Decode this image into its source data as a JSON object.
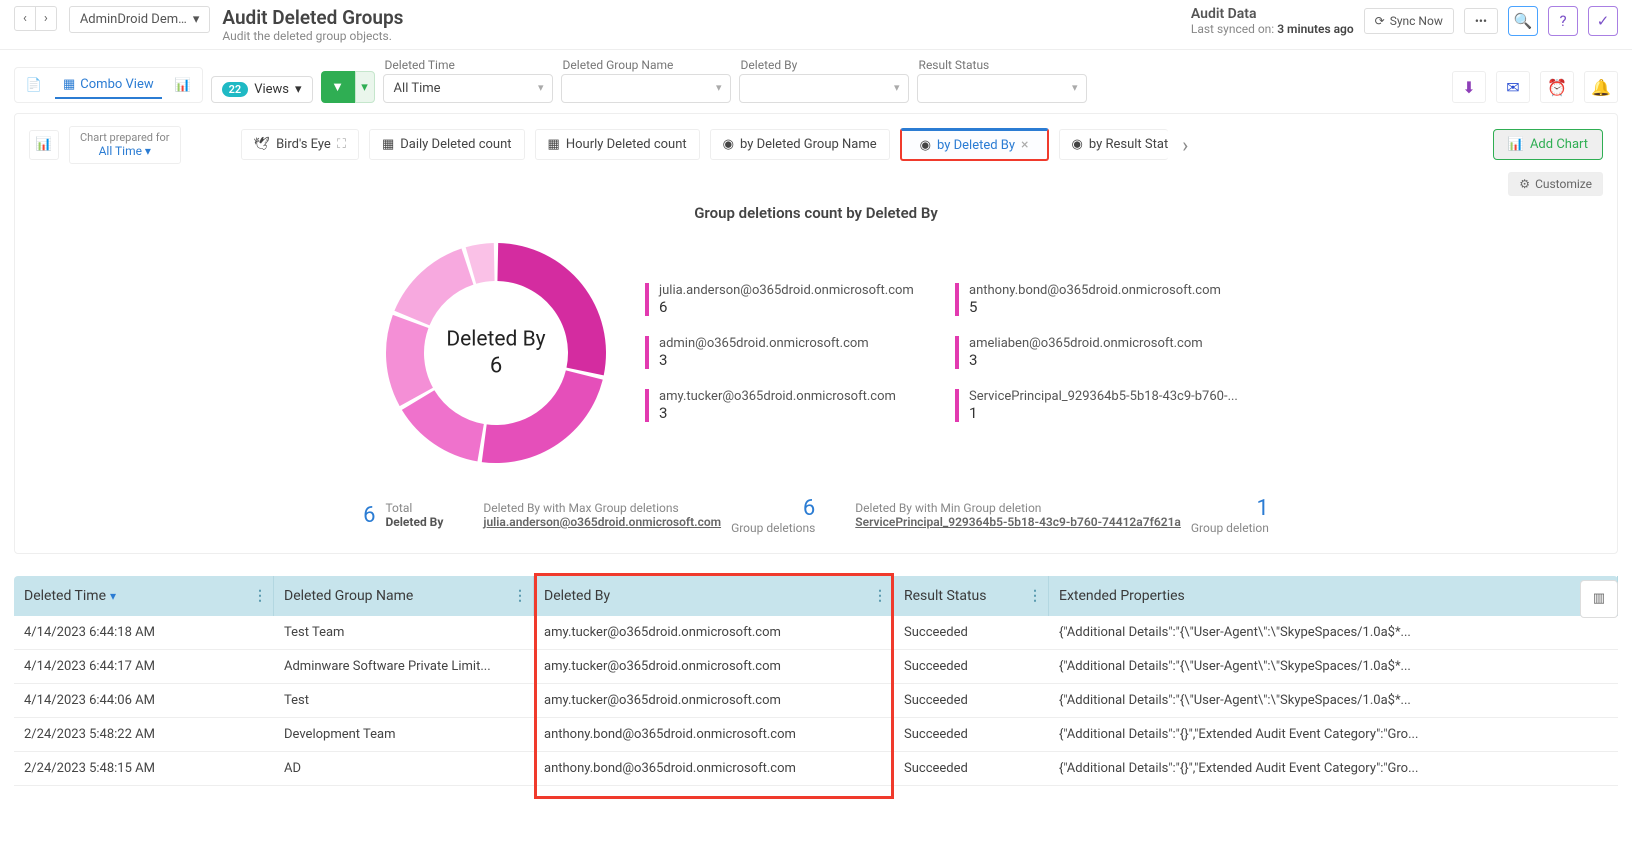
{
  "header": {
    "org": "AdminDroid Dem…",
    "title": "Audit Deleted Groups",
    "subtitle": "Audit the deleted group objects.",
    "audit_data": "Audit Data",
    "sync_label": "Last synced on: ",
    "sync_value": "3 minutes ago",
    "sync_now": "Sync Now"
  },
  "toolbar": {
    "combo_view": "Combo View",
    "views_badge": "22",
    "views": "Views",
    "filters": {
      "deleted_time_label": "Deleted Time",
      "deleted_time_value": "All Time",
      "group_name_label": "Deleted Group Name",
      "deleted_by_label": "Deleted By",
      "result_status_label": "Result Status"
    }
  },
  "chart_tabs": {
    "prep_label": "Chart prepared for",
    "prep_value": "All Time",
    "birds_eye": "Bird's Eye",
    "daily": "Daily Deleted count",
    "hourly": "Hourly Deleted count",
    "by_group": "by Deleted Group Name",
    "by_deleted_by": "by Deleted By",
    "by_result": "by Result Stat",
    "add_chart": "Add Chart",
    "customize": "Customize"
  },
  "chart": {
    "title": "Group deletions count by Deleted By",
    "center_label": "Deleted By",
    "center_value": "6"
  },
  "chart_data": {
    "type": "pie",
    "title": "Group deletions count by Deleted By",
    "series": [
      {
        "name": "julia.anderson@o365droid.onmicrosoft.com",
        "value": 6,
        "color": "#d42ca0"
      },
      {
        "name": "anthony.bond@o365droid.onmicrosoft.com",
        "value": 5,
        "color": "#e54fba"
      },
      {
        "name": "admin@o365droid.onmicrosoft.com",
        "value": 3,
        "color": "#ef72cc"
      },
      {
        "name": "ameliaben@o365droid.onmicrosoft.com",
        "value": 3,
        "color": "#f48fd6"
      },
      {
        "name": "amy.tucker@o365droid.onmicrosoft.com",
        "value": 3,
        "color": "#f7a9df"
      },
      {
        "name": "ServicePrincipal_929364b5-5b18-43c9-b760-...",
        "value": 1,
        "color": "#fac1e7"
      }
    ]
  },
  "summary": {
    "total_num": "6",
    "total_lbl1": "Total",
    "total_lbl2": "Deleted By",
    "max_lbl": "Deleted By with Max Group deletions",
    "max_name": "julia.anderson@o365droid.onmicrosoft.com",
    "max_num": "6",
    "max_unit": "Group deletions",
    "min_lbl": "Deleted By with Min Group deletion",
    "min_name": "ServicePrincipal_929364b5-5b18-43c9-b760-74412a7f621a",
    "min_num": "1",
    "min_unit": "Group deletion"
  },
  "table": {
    "columns": [
      "Deleted Time",
      "Deleted Group Name",
      "Deleted By",
      "Result Status",
      "Extended Properties"
    ],
    "rows": [
      {
        "time": "4/14/2023 6:44:18 AM",
        "name": "Test Team",
        "by": "amy.tucker@o365droid.onmicrosoft.com",
        "status": "Succeeded",
        "ext": "{\"Additional Details\":\"{\\\"User-Agent\\\":\\\"SkypeSpaces/1.0a$*..."
      },
      {
        "time": "4/14/2023 6:44:17 AM",
        "name": "Adminware Software Private Limit...",
        "by": "amy.tucker@o365droid.onmicrosoft.com",
        "status": "Succeeded",
        "ext": "{\"Additional Details\":\"{\\\"User-Agent\\\":\\\"SkypeSpaces/1.0a$*..."
      },
      {
        "time": "4/14/2023 6:44:06 AM",
        "name": "Test",
        "by": "amy.tucker@o365droid.onmicrosoft.com",
        "status": "Succeeded",
        "ext": "{\"Additional Details\":\"{\\\"User-Agent\\\":\\\"SkypeSpaces/1.0a$*..."
      },
      {
        "time": "2/24/2023 5:48:22 AM",
        "name": "Development Team",
        "by": "anthony.bond@o365droid.onmicrosoft.com",
        "status": "Succeeded",
        "ext": "{\"Additional Details\":\"{}\",\"Extended Audit Event Category\":\"Gro..."
      },
      {
        "time": "2/24/2023 5:48:15 AM",
        "name": "AD",
        "by": "anthony.bond@o365droid.onmicrosoft.com",
        "status": "Succeeded",
        "ext": "{\"Additional Details\":\"{}\",\"Extended Audit Event Category\":\"Gro..."
      }
    ]
  }
}
